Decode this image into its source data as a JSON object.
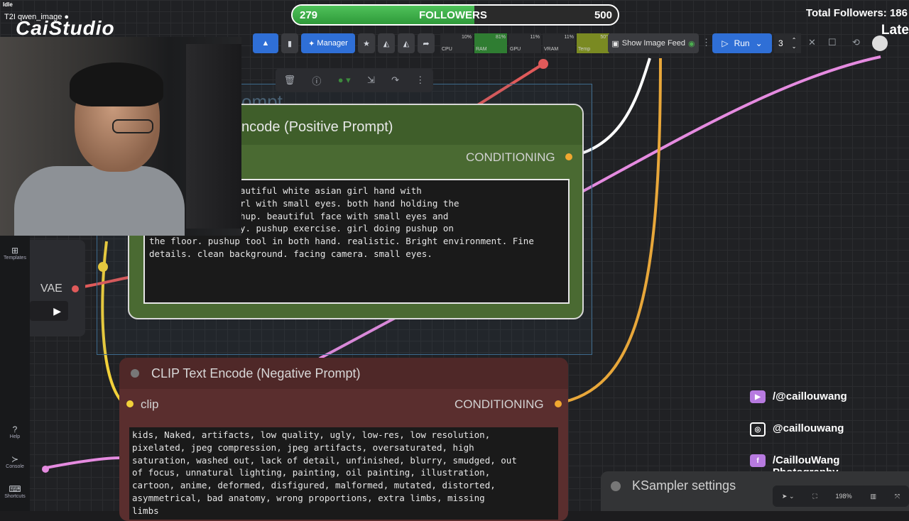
{
  "status": "Idle",
  "tab_name": "T2I qwen_image",
  "logo_text": "CaiStudio",
  "followers_bar": {
    "current": "279",
    "label": "FOLLOWERS",
    "goal": "500",
    "progress": 0.558,
    "color": "#3fb04a"
  },
  "total_followers": "Total Followers: 186",
  "late_text": "Late",
  "toolbar": {
    "manager_label": "Manager",
    "meters": [
      {
        "label": "CPU",
        "value": "10%",
        "color": "#2a2b2e"
      },
      {
        "label": "RAM",
        "value": "81%",
        "color": "#2f7d32"
      },
      {
        "label": "GPU",
        "value": "11%",
        "color": "#2a2b2e"
      },
      {
        "label": "VRAM",
        "value": "11%",
        "color": "#2a2b2e"
      },
      {
        "label": "Temp",
        "value": "50°",
        "color": "#7a8a22"
      }
    ],
    "image_feed_label": "Show Image Feed",
    "run_label": "Run",
    "queue_count": "3"
  },
  "group_title": "ompt",
  "positive_node": {
    "title": "ncode (Positive Prompt)",
    "output_label": "CONDITIONING",
    "prompt_text": "a tall and fit beautiful white asian girl hand with\n    iful asian girl with small eyes. both hand holding the\n   tool doing pushup. beautiful face with small eyes and\n   angle full body. pushup exercise. girl doing pushup on\nthe floor. pushup tool in both hand. realistic. Bright environment. Fine\ndetails. clean background. facing camera. small eyes."
  },
  "negative_node": {
    "title": "CLIP Text Encode (Negative Prompt)",
    "input_label": "clip",
    "output_label": "CONDITIONING",
    "prompt_text": "kids, Naked, artifacts, low quality, ugly, low-res, low resolution,\npixelated, jpeg compression, jpeg artifacts, oversaturated, high\nsaturation, washed out, lack of detail, unfinished, blurry, smudged, out\nof focus, unnatural lighting, painting, oil painting, illustration,\ncartoon, anime, deformed, disfigured, malformed, mutated, distorted,\nasymmetrical, bad anatomy, wrong proportions, extra limbs, missing\nlimbs"
  },
  "vae_label": "VAE",
  "sidebar": {
    "templates": "Templates",
    "help": "Help",
    "console": "Console",
    "shortcuts": "Shortcuts"
  },
  "social": {
    "youtube": "/@caillouwang",
    "instagram": "@caillouwang",
    "facebook_line1": "/CaillouWang",
    "facebook_line2": "Photography"
  },
  "ksampler_title": "KSampler settings",
  "zoom_level": "198%"
}
